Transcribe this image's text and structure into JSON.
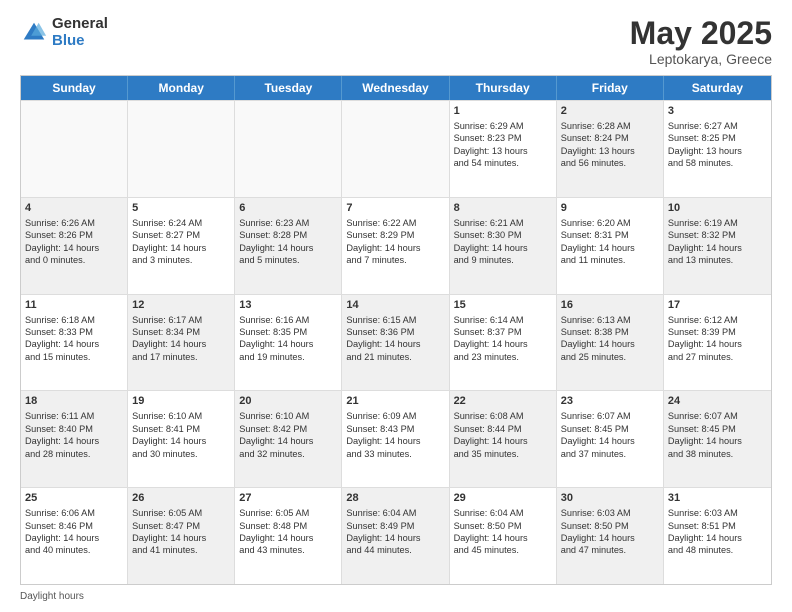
{
  "header": {
    "logo_general": "General",
    "logo_blue": "Blue",
    "title": "May 2025",
    "subtitle": "Leptokarya, Greece"
  },
  "weekdays": [
    "Sunday",
    "Monday",
    "Tuesday",
    "Wednesday",
    "Thursday",
    "Friday",
    "Saturday"
  ],
  "footer": "Daylight hours",
  "rows": [
    [
      {
        "day": "",
        "info": "",
        "shaded": false,
        "empty": true
      },
      {
        "day": "",
        "info": "",
        "shaded": false,
        "empty": true
      },
      {
        "day": "",
        "info": "",
        "shaded": false,
        "empty": true
      },
      {
        "day": "",
        "info": "",
        "shaded": false,
        "empty": true
      },
      {
        "day": "1",
        "info": "Sunrise: 6:29 AM\nSunset: 8:23 PM\nDaylight: 13 hours\nand 54 minutes.",
        "shaded": false,
        "empty": false
      },
      {
        "day": "2",
        "info": "Sunrise: 6:28 AM\nSunset: 8:24 PM\nDaylight: 13 hours\nand 56 minutes.",
        "shaded": true,
        "empty": false
      },
      {
        "day": "3",
        "info": "Sunrise: 6:27 AM\nSunset: 8:25 PM\nDaylight: 13 hours\nand 58 minutes.",
        "shaded": false,
        "empty": false
      }
    ],
    [
      {
        "day": "4",
        "info": "Sunrise: 6:26 AM\nSunset: 8:26 PM\nDaylight: 14 hours\nand 0 minutes.",
        "shaded": true,
        "empty": false
      },
      {
        "day": "5",
        "info": "Sunrise: 6:24 AM\nSunset: 8:27 PM\nDaylight: 14 hours\nand 3 minutes.",
        "shaded": false,
        "empty": false
      },
      {
        "day": "6",
        "info": "Sunrise: 6:23 AM\nSunset: 8:28 PM\nDaylight: 14 hours\nand 5 minutes.",
        "shaded": true,
        "empty": false
      },
      {
        "day": "7",
        "info": "Sunrise: 6:22 AM\nSunset: 8:29 PM\nDaylight: 14 hours\nand 7 minutes.",
        "shaded": false,
        "empty": false
      },
      {
        "day": "8",
        "info": "Sunrise: 6:21 AM\nSunset: 8:30 PM\nDaylight: 14 hours\nand 9 minutes.",
        "shaded": true,
        "empty": false
      },
      {
        "day": "9",
        "info": "Sunrise: 6:20 AM\nSunset: 8:31 PM\nDaylight: 14 hours\nand 11 minutes.",
        "shaded": false,
        "empty": false
      },
      {
        "day": "10",
        "info": "Sunrise: 6:19 AM\nSunset: 8:32 PM\nDaylight: 14 hours\nand 13 minutes.",
        "shaded": true,
        "empty": false
      }
    ],
    [
      {
        "day": "11",
        "info": "Sunrise: 6:18 AM\nSunset: 8:33 PM\nDaylight: 14 hours\nand 15 minutes.",
        "shaded": false,
        "empty": false
      },
      {
        "day": "12",
        "info": "Sunrise: 6:17 AM\nSunset: 8:34 PM\nDaylight: 14 hours\nand 17 minutes.",
        "shaded": true,
        "empty": false
      },
      {
        "day": "13",
        "info": "Sunrise: 6:16 AM\nSunset: 8:35 PM\nDaylight: 14 hours\nand 19 minutes.",
        "shaded": false,
        "empty": false
      },
      {
        "day": "14",
        "info": "Sunrise: 6:15 AM\nSunset: 8:36 PM\nDaylight: 14 hours\nand 21 minutes.",
        "shaded": true,
        "empty": false
      },
      {
        "day": "15",
        "info": "Sunrise: 6:14 AM\nSunset: 8:37 PM\nDaylight: 14 hours\nand 23 minutes.",
        "shaded": false,
        "empty": false
      },
      {
        "day": "16",
        "info": "Sunrise: 6:13 AM\nSunset: 8:38 PM\nDaylight: 14 hours\nand 25 minutes.",
        "shaded": true,
        "empty": false
      },
      {
        "day": "17",
        "info": "Sunrise: 6:12 AM\nSunset: 8:39 PM\nDaylight: 14 hours\nand 27 minutes.",
        "shaded": false,
        "empty": false
      }
    ],
    [
      {
        "day": "18",
        "info": "Sunrise: 6:11 AM\nSunset: 8:40 PM\nDaylight: 14 hours\nand 28 minutes.",
        "shaded": true,
        "empty": false
      },
      {
        "day": "19",
        "info": "Sunrise: 6:10 AM\nSunset: 8:41 PM\nDaylight: 14 hours\nand 30 minutes.",
        "shaded": false,
        "empty": false
      },
      {
        "day": "20",
        "info": "Sunrise: 6:10 AM\nSunset: 8:42 PM\nDaylight: 14 hours\nand 32 minutes.",
        "shaded": true,
        "empty": false
      },
      {
        "day": "21",
        "info": "Sunrise: 6:09 AM\nSunset: 8:43 PM\nDaylight: 14 hours\nand 33 minutes.",
        "shaded": false,
        "empty": false
      },
      {
        "day": "22",
        "info": "Sunrise: 6:08 AM\nSunset: 8:44 PM\nDaylight: 14 hours\nand 35 minutes.",
        "shaded": true,
        "empty": false
      },
      {
        "day": "23",
        "info": "Sunrise: 6:07 AM\nSunset: 8:45 PM\nDaylight: 14 hours\nand 37 minutes.",
        "shaded": false,
        "empty": false
      },
      {
        "day": "24",
        "info": "Sunrise: 6:07 AM\nSunset: 8:45 PM\nDaylight: 14 hours\nand 38 minutes.",
        "shaded": true,
        "empty": false
      }
    ],
    [
      {
        "day": "25",
        "info": "Sunrise: 6:06 AM\nSunset: 8:46 PM\nDaylight: 14 hours\nand 40 minutes.",
        "shaded": false,
        "empty": false
      },
      {
        "day": "26",
        "info": "Sunrise: 6:05 AM\nSunset: 8:47 PM\nDaylight: 14 hours\nand 41 minutes.",
        "shaded": true,
        "empty": false
      },
      {
        "day": "27",
        "info": "Sunrise: 6:05 AM\nSunset: 8:48 PM\nDaylight: 14 hours\nand 43 minutes.",
        "shaded": false,
        "empty": false
      },
      {
        "day": "28",
        "info": "Sunrise: 6:04 AM\nSunset: 8:49 PM\nDaylight: 14 hours\nand 44 minutes.",
        "shaded": true,
        "empty": false
      },
      {
        "day": "29",
        "info": "Sunrise: 6:04 AM\nSunset: 8:50 PM\nDaylight: 14 hours\nand 45 minutes.",
        "shaded": false,
        "empty": false
      },
      {
        "day": "30",
        "info": "Sunrise: 6:03 AM\nSunset: 8:50 PM\nDaylight: 14 hours\nand 47 minutes.",
        "shaded": true,
        "empty": false
      },
      {
        "day": "31",
        "info": "Sunrise: 6:03 AM\nSunset: 8:51 PM\nDaylight: 14 hours\nand 48 minutes.",
        "shaded": false,
        "empty": false
      }
    ]
  ]
}
